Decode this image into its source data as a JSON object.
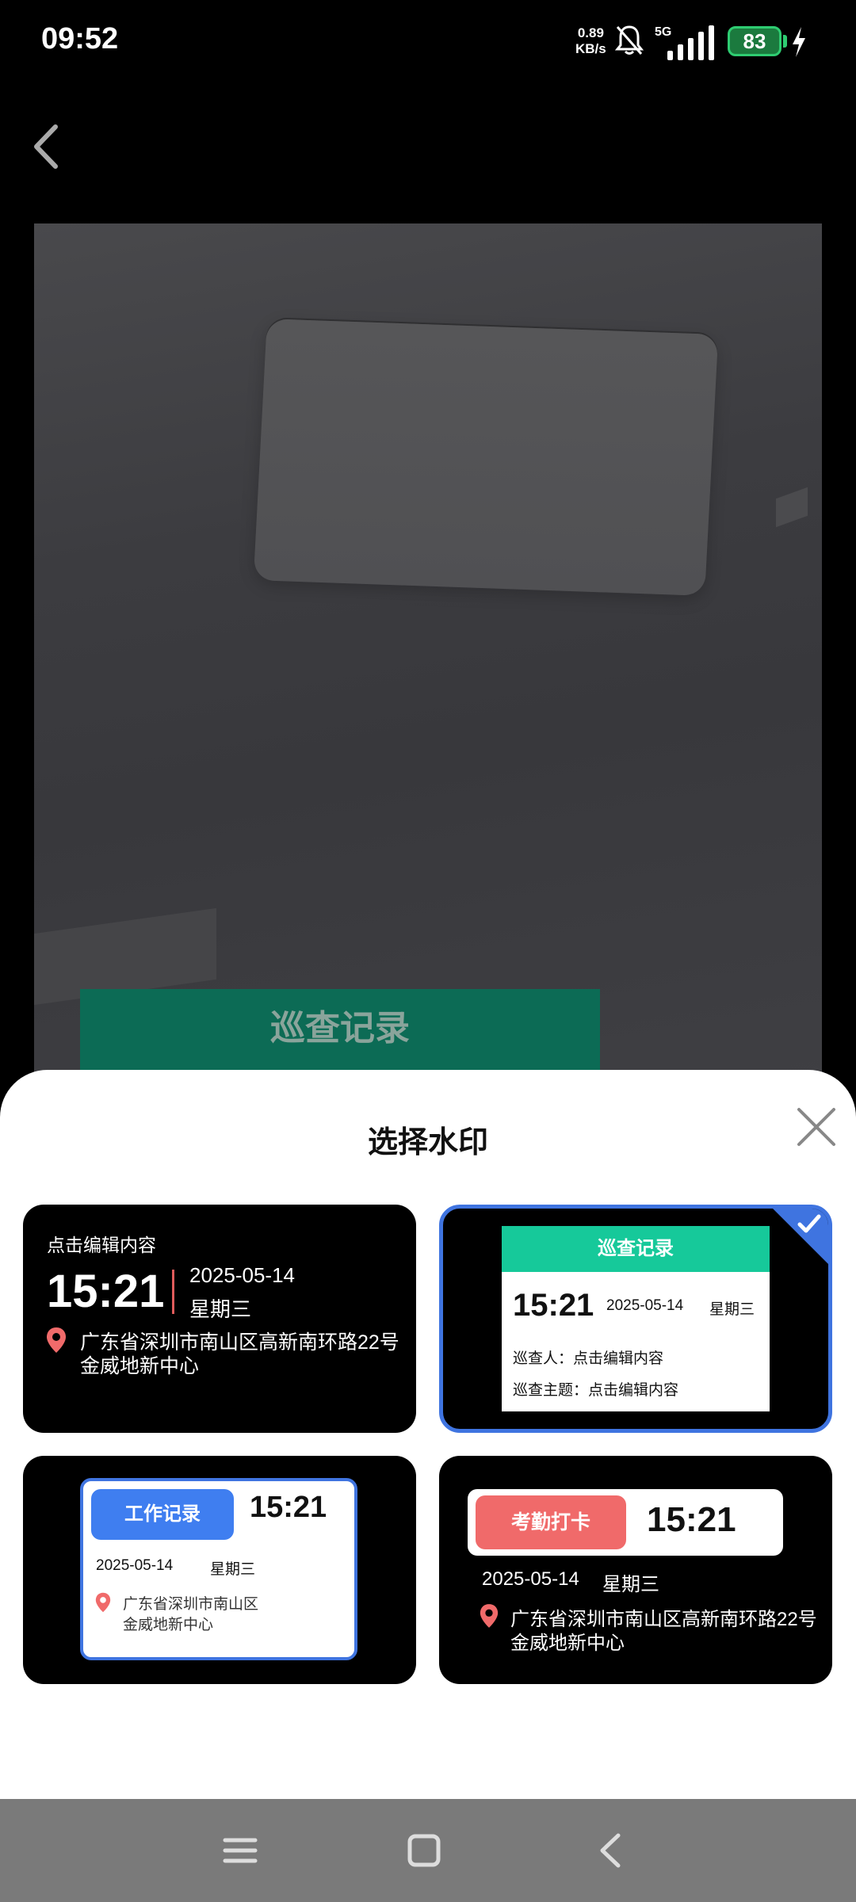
{
  "status_bar": {
    "time": "09:52",
    "net_speed_value": "0.89",
    "net_speed_unit": "KB/s",
    "network": "5G",
    "battery": "83",
    "icons": [
      "bell-mute-icon",
      "signal-icon",
      "battery-icon",
      "charging-icon"
    ]
  },
  "header": {
    "back_icon": "chevron-left-icon"
  },
  "photo": {
    "watermark_banner": "巡查记录"
  },
  "sheet": {
    "title": "选择水印",
    "close_icon": "close-icon",
    "cards": [
      {
        "hint": "点击编辑内容",
        "time": "15:21",
        "date": "2025-05-14",
        "weekday": "星期三",
        "address_line1": "广东省深圳市南山区高新南环路22号",
        "address_line2": "金威地新中心",
        "selected": false
      },
      {
        "header": "巡查记录",
        "time": "15:21",
        "date": "2025-05-14",
        "weekday": "星期三",
        "row1": "巡查人：点击编辑内容",
        "row2": "巡查主题：点击编辑内容",
        "selected": true
      },
      {
        "badge": "工作记录",
        "time": "15:21",
        "date": "2025-05-14",
        "weekday": "星期三",
        "address_line1": "广东省深圳市南山区",
        "address_line2": "金威地新中心",
        "selected": false
      },
      {
        "badge": "考勤打卡",
        "time": "15:21",
        "date": "2025-05-14",
        "weekday": "星期三",
        "address_line1": "广东省深圳市南山区高新南环路22号",
        "address_line2": "金威地新中心",
        "selected": false
      }
    ]
  },
  "navbar": {
    "icons": [
      "menu-icon",
      "home-icon",
      "back-icon"
    ]
  },
  "colors": {
    "selected_border": "#3f74e0",
    "green_header": "#16c99a",
    "blue_badge": "#3f7ef0",
    "red_badge": "#f06a6a",
    "pin": "#f06a6a"
  }
}
